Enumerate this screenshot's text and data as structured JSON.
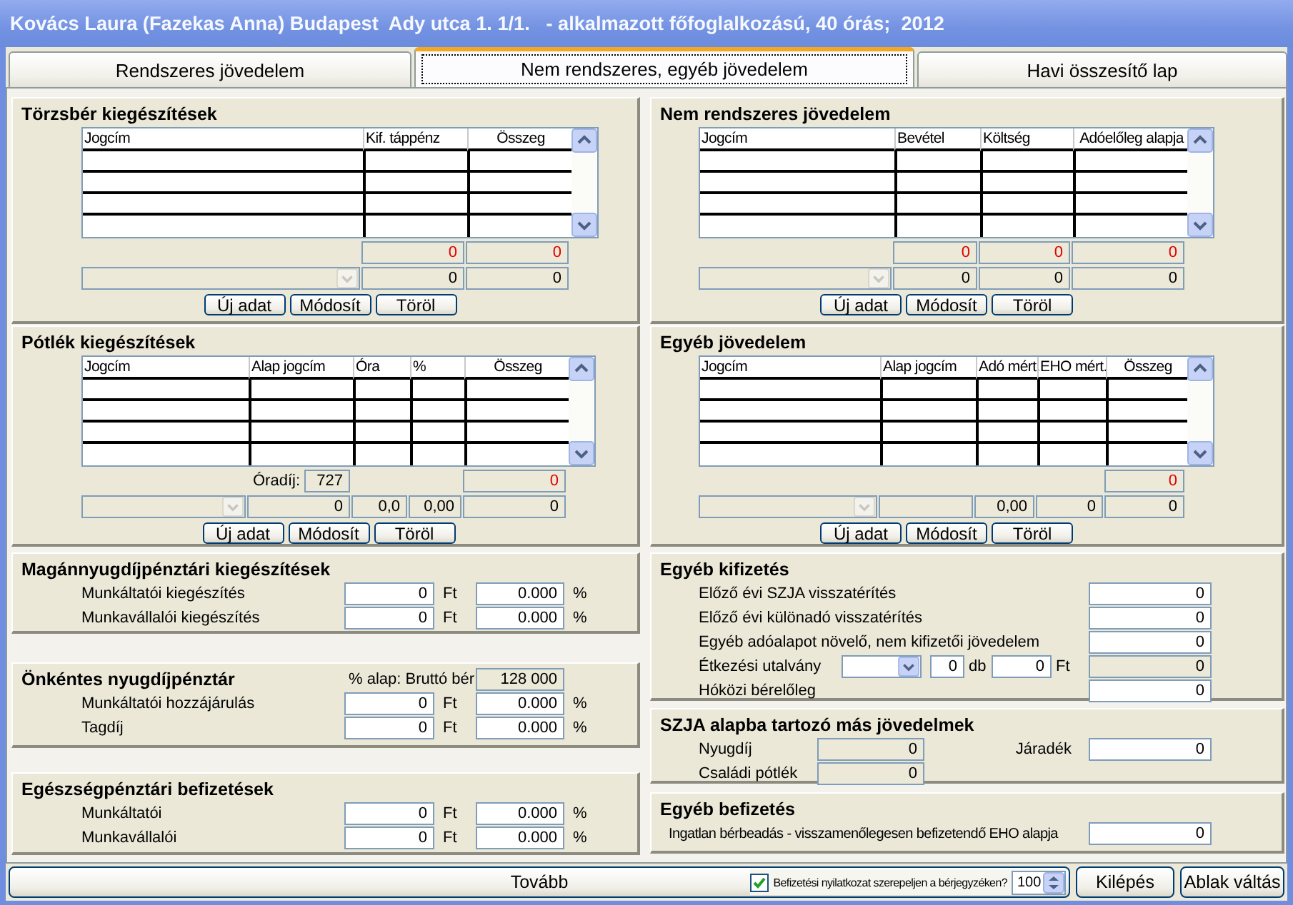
{
  "window": {
    "title": "Kovács Laura (Fazekas Anna) Budapest  Ady utca 1. 1/1.   - alkalmazott főfoglalkozású, 40 órás;  2012"
  },
  "tabs": [
    {
      "label": "Rendszeres jövedelem",
      "selected": false
    },
    {
      "label": "Nem rendszeres, egyéb jövedelem",
      "selected": true
    },
    {
      "label": "Havi összesítő lap",
      "selected": false
    }
  ],
  "left_column": [
    {
      "kind": "grid",
      "title": "Törzsbér kiegészítések",
      "columns": [
        "Jogcím",
        "Kif. táppénz",
        "Összeg"
      ],
      "summary": [
        [
          {
            "kind": "blank"
          },
          {
            "kind": "value",
            "value": "0",
            "alert": true
          },
          {
            "kind": "value",
            "value": "0",
            "alert": true
          }
        ],
        [
          {
            "kind": "combo",
            "disabled": true
          },
          {
            "kind": "value",
            "value": "0",
            "alert": false
          },
          {
            "kind": "value",
            "value": "0",
            "alert": false
          }
        ]
      ],
      "buttons": [
        "Új adat",
        "Módosít",
        "Töröl"
      ]
    },
    {
      "kind": "grid",
      "title": "Pótlék kiegészítések",
      "columns": [
        "Jogcím",
        "Alap jogcím",
        "Óra",
        "%",
        "Összeg"
      ],
      "summary": [
        [
          {
            "kind": "blank"
          },
          {
            "kind": "labeled",
            "label": "Óradíj:",
            "value": "727"
          },
          {
            "kind": "blank"
          },
          {
            "kind": "blank"
          },
          {
            "kind": "value",
            "value": "0",
            "alert": true
          }
        ],
        [
          {
            "kind": "combo",
            "disabled": true
          },
          {
            "kind": "value",
            "value": "0",
            "alert": false
          },
          {
            "kind": "value",
            "value": "0,0",
            "alert": false
          },
          {
            "kind": "value",
            "value": "0,00",
            "alert": false
          },
          {
            "kind": "value",
            "value": "0",
            "alert": false
          }
        ]
      ],
      "buttons": [
        "Új adat",
        "Módosít",
        "Töröl"
      ]
    },
    {
      "kind": "contrib",
      "title": "Magánnyugdíjpénztári kiegészítések",
      "rows": [
        {
          "label": "Munkáltatói kiegészítés",
          "amount": "0",
          "unit": "Ft",
          "percent": "0.000",
          "percent_unit": "%"
        },
        {
          "label": "Munkavállalói kiegészítés",
          "amount": "0",
          "unit": "Ft",
          "percent": "0.000",
          "percent_unit": "%"
        }
      ]
    },
    {
      "kind": "contrib",
      "title": "Önkéntes nyugdíjpénztár",
      "base": {
        "label": "% alap: Bruttó bér",
        "value": "128 000"
      },
      "rows": [
        {
          "label": "Munkáltatói hozzájárulás",
          "amount": "0",
          "unit": "Ft",
          "percent": "0.000",
          "percent_unit": "%"
        },
        {
          "label": "Tagdíj",
          "amount": "0",
          "unit": "Ft",
          "percent": "0.000",
          "percent_unit": "%"
        }
      ]
    },
    {
      "kind": "contrib",
      "title": "Egészségpénztári befizetések",
      "rows": [
        {
          "label": "Munkáltatói",
          "amount": "0",
          "unit": "Ft",
          "percent": "0.000",
          "percent_unit": "%"
        },
        {
          "label": "Munkavállalói",
          "amount": "0",
          "unit": "Ft",
          "percent": "0.000",
          "percent_unit": "%"
        }
      ]
    }
  ],
  "right_column": [
    {
      "kind": "grid",
      "title": "Nem rendszeres jövedelem",
      "columns": [
        "Jogcím",
        "Bevétel",
        "Költség",
        "Adóelőleg alapja"
      ],
      "summary": [
        [
          {
            "kind": "blank"
          },
          {
            "kind": "value",
            "value": "0",
            "alert": true
          },
          {
            "kind": "value",
            "value": "0",
            "alert": true
          },
          {
            "kind": "value",
            "value": "0",
            "alert": true
          }
        ],
        [
          {
            "kind": "combo",
            "disabled": true
          },
          {
            "kind": "value",
            "value": "0",
            "alert": false
          },
          {
            "kind": "value",
            "value": "0",
            "alert": false
          },
          {
            "kind": "value",
            "value": "0",
            "alert": false
          }
        ]
      ],
      "buttons": [
        "Új adat",
        "Módosít",
        "Töröl"
      ]
    },
    {
      "kind": "grid",
      "title": "Egyéb jövedelem",
      "columns": [
        "Jogcím",
        "Alap jogcím",
        "Adó mért.",
        "EHO mért.",
        "Összeg"
      ],
      "summary": [
        [
          {
            "kind": "blank"
          },
          {
            "kind": "blank"
          },
          {
            "kind": "blank"
          },
          {
            "kind": "blank"
          },
          {
            "kind": "value",
            "value": "0",
            "alert": true
          }
        ],
        [
          {
            "kind": "combo",
            "disabled": true
          },
          {
            "kind": "box"
          },
          {
            "kind": "value",
            "value": "0,00",
            "alert": false
          },
          {
            "kind": "value",
            "value": "0",
            "alert": false
          },
          {
            "kind": "value",
            "value": "0",
            "alert": false
          }
        ]
      ],
      "buttons": [
        "Új adat",
        "Módosít",
        "Töröl"
      ]
    },
    {
      "kind": "fields",
      "title": "Egyéb kifizetés",
      "rows": [
        {
          "kind": "field",
          "label": "Előző évi SZJA visszatérítés",
          "value": "0",
          "readonly": false
        },
        {
          "kind": "field",
          "label": "Előző évi különadó visszatérítés",
          "value": "0",
          "readonly": false
        },
        {
          "kind": "field",
          "label": "Egyéb adóalapot növelő, nem kifizetői jövedelem",
          "value": "0",
          "readonly": false
        },
        {
          "kind": "voucher",
          "label": "Étkezési utalvány",
          "type_disabled": false,
          "count": "0",
          "count_unit": "db",
          "amount": "0",
          "amount_unit": "Ft",
          "value": "0",
          "readonly": true
        },
        {
          "kind": "field",
          "label": "Hóközi bérelőleg",
          "value": "0",
          "readonly": false
        }
      ]
    },
    {
      "kind": "pairs",
      "title": "SZJA alapba tartozó más jövedelmek",
      "items": [
        {
          "label": "Nyugdíj",
          "value": "0",
          "readonly": true
        },
        {
          "label": "Járadék",
          "value": "0",
          "readonly": false
        },
        {
          "label": "Családi pótlék",
          "value": "0",
          "readonly": true
        }
      ]
    },
    {
      "kind": "fields",
      "title": "Egyéb befizetés",
      "rows": [
        {
          "kind": "field",
          "label": "Ingatlan bérbeadás - visszamenőlegesen befizetendő EHO alapja",
          "value": "0",
          "readonly": false
        }
      ]
    }
  ],
  "bottom_bar": {
    "continue_button": "Tovább",
    "declaration": {
      "label": "Befizetési nyilatkozat szerepeljen a bérjegyzéken?",
      "checked": true
    },
    "copies": "100",
    "buttons": [
      "Kilépés",
      "Ablak váltás"
    ]
  }
}
